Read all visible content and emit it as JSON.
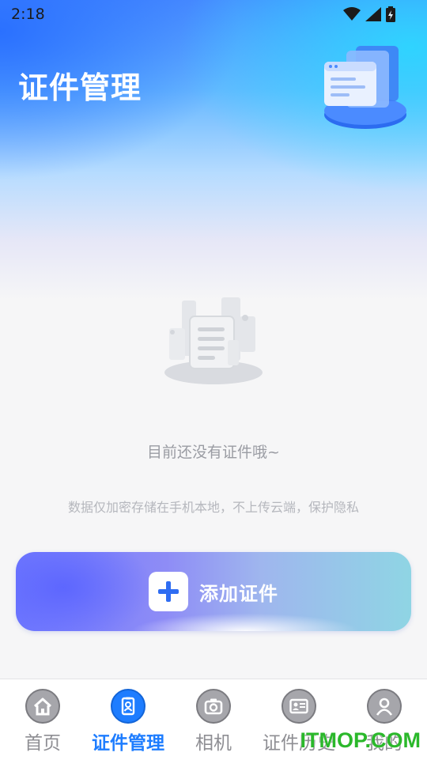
{
  "status_bar": {
    "time": "2:18"
  },
  "header": {
    "title": "证件管理"
  },
  "empty_state": {
    "message": "目前还没有证件哦~",
    "privacy_note": "数据仅加密存储在手机本地，不上传云端，保护隐私"
  },
  "add_button": {
    "label": "添加证件"
  },
  "tabbar": {
    "tabs": [
      {
        "label": "首页",
        "icon": "home-icon",
        "active": false
      },
      {
        "label": "证件管理",
        "icon": "id-badge-icon",
        "active": true
      },
      {
        "label": "相机",
        "icon": "camera-icon",
        "active": false
      },
      {
        "label": "证件历史",
        "icon": "id-card-icon",
        "active": false
      },
      {
        "label": "我的",
        "icon": "user-icon",
        "active": false
      }
    ]
  },
  "watermark": "ITMOP.COM",
  "colors": {
    "accent": "#1e7dff",
    "inactive": "#8e8e93"
  }
}
